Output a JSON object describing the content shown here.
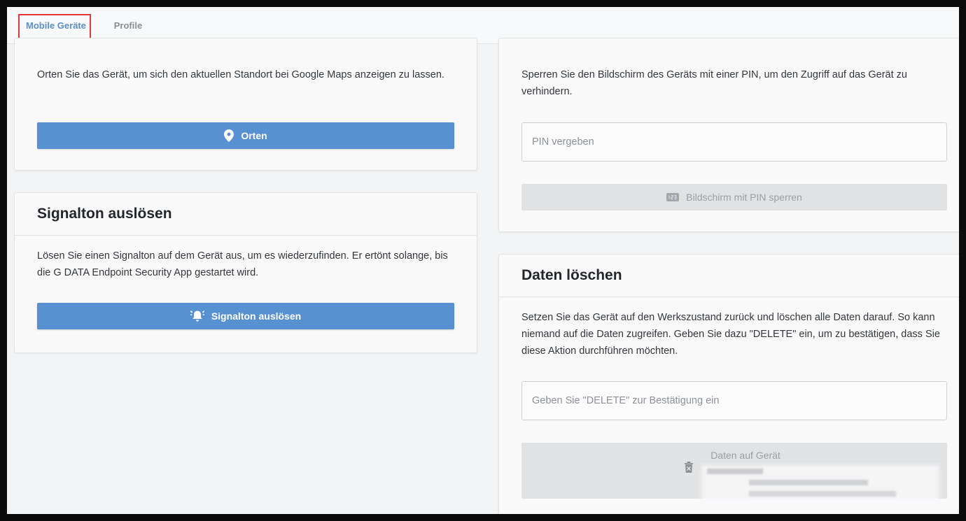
{
  "tabs": [
    {
      "label": "Mobile Geräte",
      "active": true
    },
    {
      "label": "Profile",
      "active": false
    }
  ],
  "locate": {
    "description": "Orten Sie das Gerät, um sich den aktuellen Standort bei Google Maps anzeigen zu lassen.",
    "button_label": "Orten"
  },
  "signal": {
    "title": "Signalton auslösen",
    "description": "Lösen Sie einen Signalton auf dem Gerät aus, um es wiederzufinden. Er ertönt solange, bis die G DATA Endpoint Security App gestartet wird.",
    "button_label": "Signalton auslösen"
  },
  "lock": {
    "description": "Sperren Sie den Bildschirm des Geräts mit einer PIN, um den Zugriff auf das Gerät zu verhindern.",
    "pin_placeholder": "PIN vergeben",
    "button_label": "Bildschirm mit PIN sperren"
  },
  "wipe": {
    "title": "Daten löschen",
    "description": "Setzen Sie das Gerät auf den Werkszustand zurück und löschen alle Daten darauf. So kann niemand auf die Daten zugreifen. Geben Sie dazu \"DELETE\" ein, um zu bestätigen, dass Sie diese Aktion durchführen möchten.",
    "confirm_placeholder": "Geben Sie \"DELETE\" zur Bestätigung ein",
    "button_label": "Daten auf Gerät"
  },
  "colors": {
    "accent": "#5891d2",
    "highlight": "#e0383b",
    "disabled": "#e1e2e3"
  }
}
